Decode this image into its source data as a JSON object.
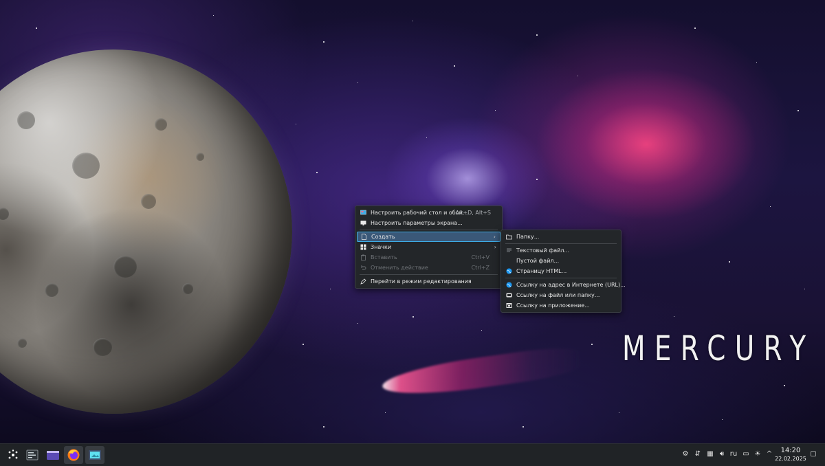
{
  "wallpaper": {
    "title": "MERCURY",
    "colors": {
      "nebula_pink": "#ff4682",
      "nebula_violet": "#6e46c8",
      "space_dark": "#140f2e"
    }
  },
  "context_menu": {
    "items": [
      {
        "label": "Настроить рабочий стол и обои...",
        "shortcut": "Alt+D, Alt+S",
        "icon": "desktop-settings-icon",
        "enabled": true
      },
      {
        "label": "Настроить параметры экрана...",
        "shortcut": "",
        "icon": "monitor-icon",
        "enabled": true
      },
      {
        "label": "Создать",
        "shortcut": "",
        "icon": "new-document-icon",
        "enabled": true,
        "submenu": true,
        "active": true
      },
      {
        "label": "Значки",
        "shortcut": "",
        "icon": "icons-grid-icon",
        "enabled": true,
        "submenu": true
      },
      {
        "label": "Вставить",
        "shortcut": "Ctrl+V",
        "icon": "paste-icon",
        "enabled": false
      },
      {
        "label": "Отменить действие",
        "shortcut": "Ctrl+Z",
        "icon": "undo-icon",
        "enabled": false
      },
      {
        "label": "Перейти в режим редактирования",
        "shortcut": "",
        "icon": "edit-mode-icon",
        "enabled": true
      }
    ]
  },
  "create_submenu": {
    "items": [
      {
        "label": "Папку...",
        "icon": "folder-icon"
      },
      {
        "label": "Текстовый файл...",
        "icon": "text-file-icon"
      },
      {
        "label": "Пустой файл...",
        "icon": "empty-file-icon"
      },
      {
        "label": "Страницу HTML...",
        "icon": "html-globe-icon"
      },
      {
        "label": "Ссылку на адрес в Интернете (URL)...",
        "icon": "url-globe-icon"
      },
      {
        "label": "Ссылку на файл или папку...",
        "icon": "file-link-icon"
      },
      {
        "label": "Ссылку на приложение...",
        "icon": "app-link-icon"
      }
    ]
  },
  "taskbar": {
    "apps": [
      "application-launcher",
      "system-settings",
      "dolphin-file-manager",
      "firefox",
      "screen-capture"
    ],
    "tray": {
      "keyboard_layout": "ru",
      "time": "14:20",
      "date": "22.02.2025"
    }
  },
  "accent_color": "#3daee9"
}
